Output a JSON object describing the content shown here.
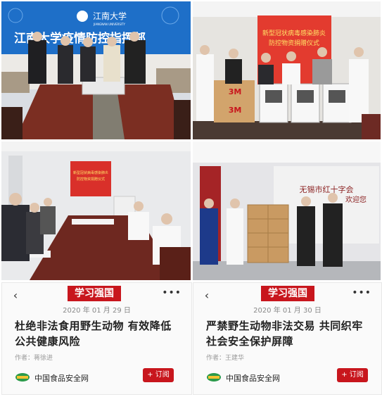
{
  "photos": {
    "top_left": {
      "banner_logo": "江南大学",
      "banner_logo_en": "JIANGNAN UNIVERSITY",
      "banner_text": "江南大学疫情防控指挥部"
    },
    "top_right": {
      "board_text_1": "新型冠状病毒感染肺炎",
      "board_text_2": "防控物资捐赠仪式",
      "box_label": "3M"
    },
    "bottom_left": {
      "screen_text_1": "新型冠状病毒感染肺炎",
      "screen_text_2": "防控物资捐赠仪式"
    },
    "bottom_right": {
      "wall_text": "无锡市红十字会",
      "wall_text_2": "欢迎您"
    }
  },
  "articles": [
    {
      "brand": "学习强国",
      "date": "2020 年 01 月 29 日",
      "headline": "杜绝非法食用野生动物 有效降低公共健康风险",
      "author": "作者：蒋徐进",
      "source": "中国食品安全网",
      "subscribe": "+ 订阅",
      "back": "‹",
      "more": "•••"
    },
    {
      "brand": "学习强国",
      "date": "2020 年 01 月 30 日",
      "headline": "严禁野生动物非法交易 共同织牢社会安全保护屏障",
      "author": "作者：王建华",
      "source": "中国食品安全网",
      "subscribe": "+ 订阅",
      "back": "‹",
      "more": "•••"
    }
  ],
  "colors": {
    "brand_red": "#c8161d",
    "banner_blue": "#1e6fc8"
  }
}
